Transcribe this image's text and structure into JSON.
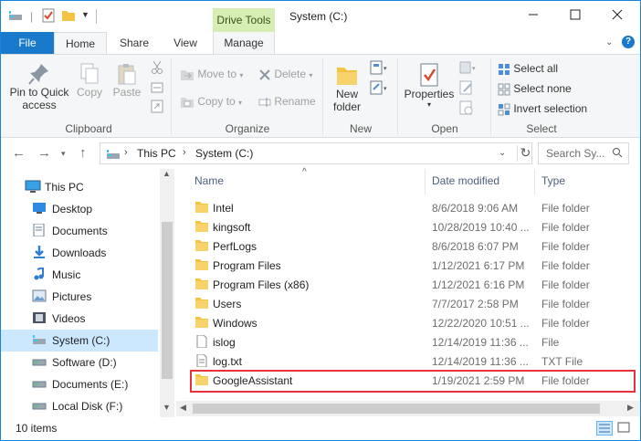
{
  "window": {
    "title": "System (C:)",
    "contextual_tab_group": "Drive Tools"
  },
  "tabs": [
    "File",
    "Home",
    "Share",
    "View",
    "Manage"
  ],
  "ribbon": {
    "clipboard": {
      "label": "Clipboard",
      "pin_line1": "Pin to Quick",
      "pin_line2": "access",
      "copy": "Copy",
      "paste": "Paste"
    },
    "organize": {
      "label": "Organize",
      "move_to": "Move to",
      "copy_to": "Copy to",
      "delete": "Delete",
      "rename": "Rename"
    },
    "new": {
      "label": "New",
      "new_folder_line1": "New",
      "new_folder_line2": "folder"
    },
    "open": {
      "label": "Open",
      "properties": "Properties"
    },
    "select": {
      "label": "Select",
      "select_all": "Select all",
      "select_none": "Select none",
      "invert_selection": "Invert selection"
    }
  },
  "address": {
    "crumbs": [
      "This PC",
      "System (C:)"
    ],
    "search_placeholder": "Search Sy..."
  },
  "nav_pane": [
    {
      "label": "This PC",
      "icon": "computer-icon",
      "root": true
    },
    {
      "label": "Desktop",
      "icon": "desktop-icon"
    },
    {
      "label": "Documents",
      "icon": "documents-icon"
    },
    {
      "label": "Downloads",
      "icon": "downloads-icon"
    },
    {
      "label": "Music",
      "icon": "music-icon"
    },
    {
      "label": "Pictures",
      "icon": "pictures-icon"
    },
    {
      "label": "Videos",
      "icon": "videos-icon"
    },
    {
      "label": "System (C:)",
      "icon": "system-drive-icon",
      "selected": true
    },
    {
      "label": "Software (D:)",
      "icon": "drive-icon"
    },
    {
      "label": "Documents (E:)",
      "icon": "drive-icon"
    },
    {
      "label": "Local Disk (F:)",
      "icon": "drive-icon"
    }
  ],
  "columns": {
    "name": "Name",
    "date": "Date modified",
    "type": "Type"
  },
  "files": [
    {
      "name": "Intel",
      "date": "8/6/2018 9:06 AM",
      "type": "File folder",
      "kind": "folder"
    },
    {
      "name": "kingsoft",
      "date": "10/28/2019 10:40 ...",
      "type": "File folder",
      "kind": "folder"
    },
    {
      "name": "PerfLogs",
      "date": "8/6/2018 6:07 PM",
      "type": "File folder",
      "kind": "folder"
    },
    {
      "name": "Program Files",
      "date": "1/12/2021 6:17 PM",
      "type": "File folder",
      "kind": "folder"
    },
    {
      "name": "Program Files (x86)",
      "date": "1/12/2021 6:16 PM",
      "type": "File folder",
      "kind": "folder"
    },
    {
      "name": "Users",
      "date": "7/7/2017 2:58 PM",
      "type": "File folder",
      "kind": "folder"
    },
    {
      "name": "Windows",
      "date": "12/22/2020 10:51 ...",
      "type": "File folder",
      "kind": "folder"
    },
    {
      "name": "islog",
      "date": "12/14/2019 11:36 ...",
      "type": "File",
      "kind": "file"
    },
    {
      "name": "log.txt",
      "date": "12/14/2019 11:36 ...",
      "type": "TXT File",
      "kind": "txt"
    },
    {
      "name": "GoogleAssistant",
      "date": "1/19/2021 2:59 PM",
      "type": "File folder",
      "kind": "folder",
      "highlighted": true
    }
  ],
  "status": {
    "item_count": "10 items"
  },
  "colors": {
    "accent": "#1979ca",
    "drive_tools": "#d6eeb3",
    "highlight_border": "#e8313a",
    "folder": "#f5c342",
    "selection": "#cce8ff"
  }
}
